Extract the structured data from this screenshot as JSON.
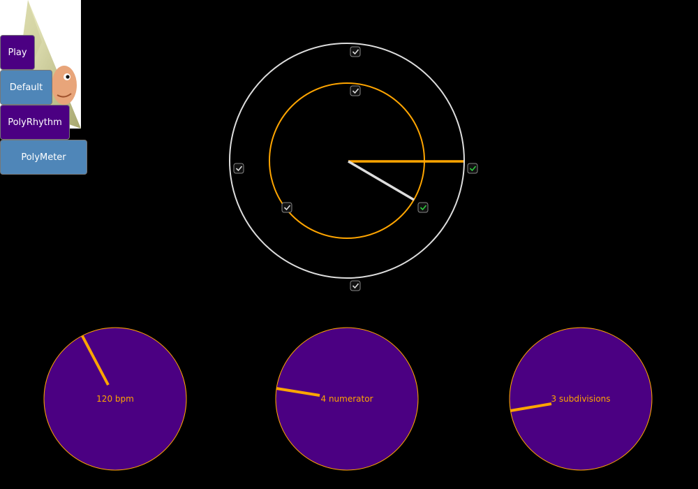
{
  "buttons": {
    "play": "Play",
    "default": "Default",
    "polyrhythm": "PolyRhythm",
    "polymeter": "PolyMeter"
  },
  "colors": {
    "background": "#000000",
    "accent": "#ffa500",
    "outer_ring": "#dddddd",
    "knob_fill": "#4b0082",
    "button_purple": "#4b0082",
    "button_steel": "#4f86b8",
    "checked_green": "#2ecc40"
  },
  "rhythm_display": {
    "outer_beats": 4,
    "inner_beats": 3,
    "outer_checked_active_beat": 1,
    "inner_checked_active_beat": 1
  },
  "knobs": [
    {
      "id": "bpm",
      "value": 120,
      "unit": "bpm",
      "label": "120 bpm"
    },
    {
      "id": "numerator",
      "value": 4,
      "unit": "numerator",
      "label": "4 numerator"
    },
    {
      "id": "subdivisions",
      "value": 3,
      "unit": "subdivisions",
      "label": "3 subdivisions"
    }
  ]
}
